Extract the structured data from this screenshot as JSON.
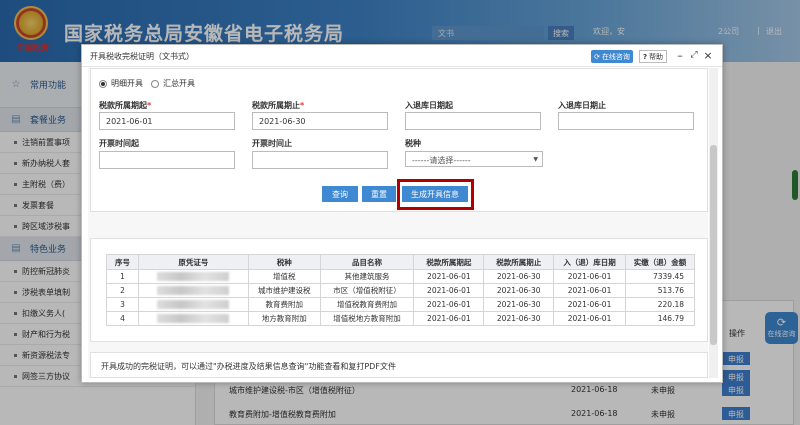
{
  "header": {
    "emblem_text": "中国税务",
    "title": "国家税务总局安徽省电子税务局",
    "search_placeholder": "文书",
    "search_button": "搜索",
    "welcome": "欢迎，安",
    "right_text": "2公司",
    "exit": "退出"
  },
  "sidebar": {
    "favorites": "常用功能",
    "section1": "套餐业务",
    "section1_items": [
      "注销前置事项",
      "新办纳税人套",
      "主附税（费）",
      "发票套餐",
      "跨区域涉税事"
    ],
    "section2": "特色业务",
    "section2_items": [
      "防控新冠肺炎",
      "涉税表单填制",
      "扣缴义务人(",
      "财产和行为税",
      "新资源税法专",
      "网签三方协议"
    ]
  },
  "background": {
    "op_header": "操作",
    "rows": [
      {
        "name": "城市维护建设税-市区（增值税附征）",
        "date": "2021-06-18",
        "status": "未申报",
        "action": "申报"
      },
      {
        "name": "教育费附加-增值税教育费附加",
        "date": "2021-06-18",
        "status": "未申报",
        "action": "申报"
      }
    ],
    "extra_buttons": [
      "申报",
      "申报"
    ],
    "float_button": "在线咨询"
  },
  "modal": {
    "title": "开具税收完税证明（文书式）",
    "online_btn": "在线咨询",
    "help_btn": "帮助",
    "radio_detail": "明细开具",
    "radio_summary": "汇总开具",
    "fields": {
      "tax_period_start_label": "税款所属期起",
      "tax_period_start_value": "2021-06-01",
      "tax_period_end_label": "税款所属期止",
      "tax_period_end_value": "2021-06-30",
      "storage_start_label": "入退库日期起",
      "storage_end_label": "入退库日期止",
      "invoice_start_label": "开票时间起",
      "invoice_end_label": "开票时间止",
      "tax_type_label": "税种",
      "tax_type_placeholder": "------请选择------"
    },
    "buttons": {
      "query": "查询",
      "reset": "重置",
      "generate": "生成开具信息"
    },
    "table": {
      "headers": [
        "序号",
        "原凭证号",
        "税种",
        "品目名称",
        "税款所属期起",
        "税款所属期止",
        "入（退）库日期",
        "实缴（退）金额"
      ],
      "rows": [
        {
          "no": "1",
          "tax": "增值税",
          "item": "其他建筑服务",
          "start": "2021-06-01",
          "end": "2021-06-30",
          "date": "2021-06-01",
          "amount": "7339.45"
        },
        {
          "no": "2",
          "tax": "城市维护建设税",
          "item": "市区（增值税附征）",
          "start": "2021-06-01",
          "end": "2021-06-30",
          "date": "2021-06-01",
          "amount": "513.76"
        },
        {
          "no": "3",
          "tax": "教育费附加",
          "item": "增值税教育费附加",
          "start": "2021-06-01",
          "end": "2021-06-30",
          "date": "2021-06-01",
          "amount": "220.18"
        },
        {
          "no": "4",
          "tax": "地方教育附加",
          "item": "增值税地方教育附加",
          "start": "2021-06-01",
          "end": "2021-06-30",
          "date": "2021-06-01",
          "amount": "146.79"
        }
      ]
    },
    "note": "开具成功的完税证明，可以通过\"办税进度及结果信息查询\"功能查看和复打PDF文件"
  }
}
